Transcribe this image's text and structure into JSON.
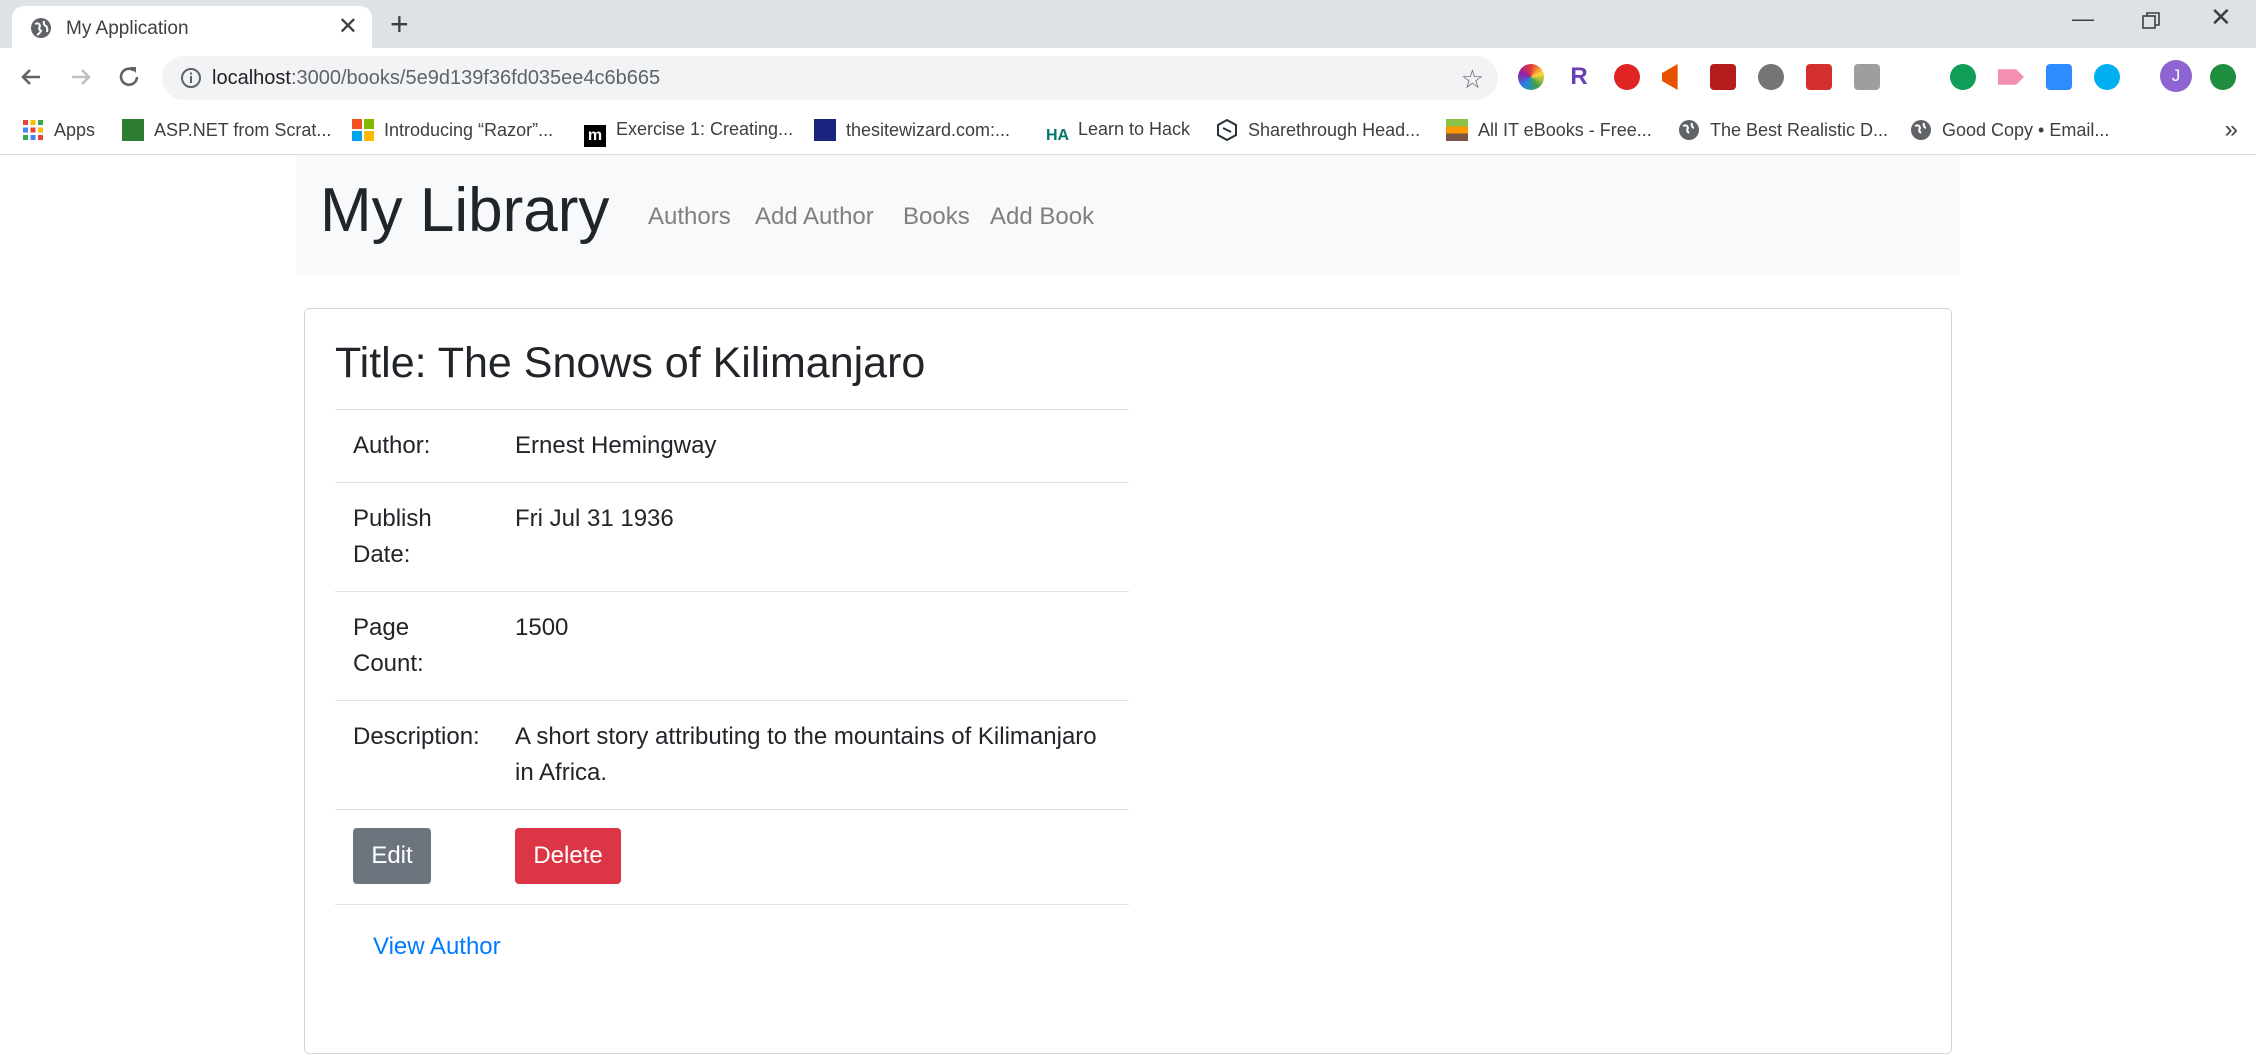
{
  "browser": {
    "tab_title": "My Application",
    "url_host": "localhost",
    "url_rest": ":3000/books/5e9d139f36fd035ee4c6b665",
    "profile_initial": "J"
  },
  "bookmarks": [
    {
      "label": "Apps",
      "icon": "apps-grid-icon"
    },
    {
      "label": "ASP.NET from Scrat...",
      "icon": "bookmark-icon"
    },
    {
      "label": "Introducing “Razor”...",
      "icon": "microsoft-icon"
    },
    {
      "label": "Exercise 1: Creating...",
      "icon": "m-icon"
    },
    {
      "label": "thesitewizard.com:...",
      "icon": "site-icon"
    },
    {
      "label": "Learn to Hack",
      "icon": "ha-icon"
    },
    {
      "label": "Sharethrough Head...",
      "icon": "sharethrough-icon"
    },
    {
      "label": "All IT eBooks - Free...",
      "icon": "books-icon"
    },
    {
      "label": "The Best Realistic D...",
      "icon": "globe-icon"
    },
    {
      "label": "Good Copy • Email...",
      "icon": "globe-icon"
    }
  ],
  "navbar": {
    "brand": "My Library",
    "links": [
      "Authors",
      "Add Author",
      "Books",
      "Add Book"
    ]
  },
  "book": {
    "title": "Title: The Snows of Kilimanjaro",
    "rows": [
      {
        "label": "Author:",
        "value": "Ernest Hemingway"
      },
      {
        "label": "Publish Date:",
        "value": "Fri Jul 31 1936"
      },
      {
        "label": "Page Count:",
        "value": "1500"
      },
      {
        "label": "Description:",
        "value": "A short story attributing to the mountains of Kilimanjaro in Africa."
      }
    ],
    "edit_label": "Edit",
    "delete_label": "Delete",
    "view_author_label": "View Author"
  },
  "colors": {
    "link": "#007bff",
    "edit_button": "#6c757d",
    "delete_button": "#dc3545",
    "navbar_bg": "#f8f9fa"
  }
}
